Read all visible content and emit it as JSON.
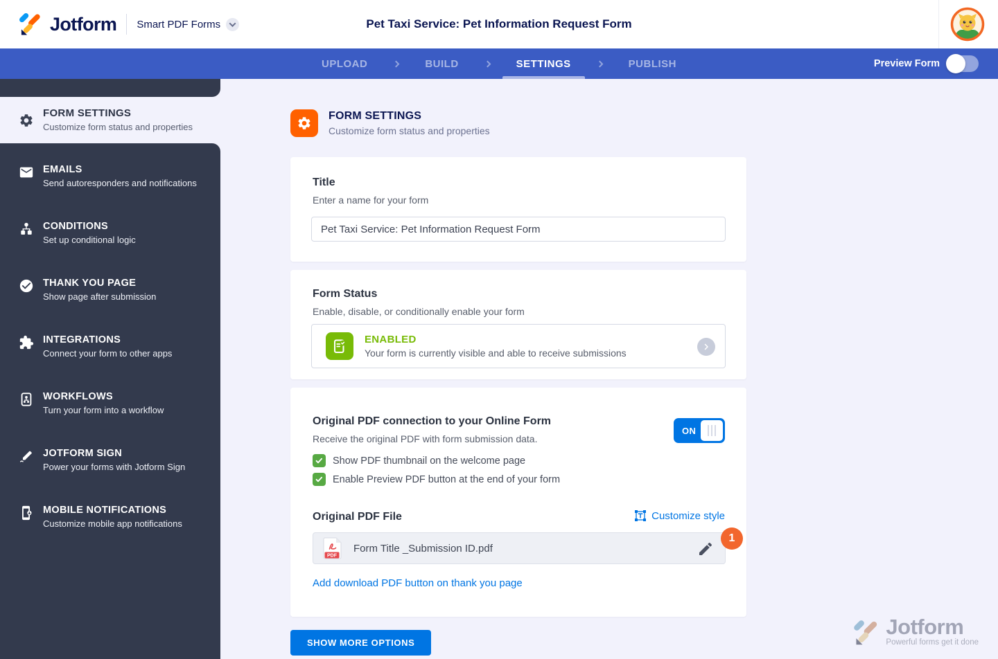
{
  "header": {
    "brand": "Jotform",
    "product": "Smart PDF Forms",
    "page_title": "Pet Taxi Service: Pet Information Request Form"
  },
  "navbar": {
    "tabs": [
      {
        "label": "UPLOAD",
        "active": false
      },
      {
        "label": "BUILD",
        "active": false
      },
      {
        "label": "SETTINGS",
        "active": true
      },
      {
        "label": "PUBLISH",
        "active": false
      }
    ],
    "preview_label": "Preview Form",
    "preview_toggle_state": "off"
  },
  "sidebar": {
    "items": [
      {
        "label": "FORM SETTINGS",
        "description": "Customize form status and properties",
        "icon": "gear-icon",
        "active": true
      },
      {
        "label": "EMAILS",
        "description": "Send autoresponders and notifications",
        "icon": "envelope-icon",
        "active": false
      },
      {
        "label": "CONDITIONS",
        "description": "Set up conditional logic",
        "icon": "flowchart-icon",
        "active": false
      },
      {
        "label": "THANK YOU PAGE",
        "description": "Show page after submission",
        "icon": "check-circle-icon",
        "active": false
      },
      {
        "label": "INTEGRATIONS",
        "description": "Connect your form to other apps",
        "icon": "puzzle-icon",
        "active": false
      },
      {
        "label": "WORKFLOWS",
        "description": "Turn your form into a workflow",
        "icon": "workflow-icon",
        "active": false
      },
      {
        "label": "JOTFORM SIGN",
        "description": "Power your forms with Jotform Sign",
        "icon": "sign-pen-icon",
        "active": false
      },
      {
        "label": "MOBILE NOTIFICATIONS",
        "description": "Customize mobile app notifications",
        "icon": "mobile-icon",
        "active": false
      }
    ]
  },
  "main": {
    "section": {
      "title": "FORM SETTINGS",
      "subtitle": "Customize form status and properties"
    },
    "title_card": {
      "label": "Title",
      "hint": "Enter a name for your form",
      "value": "Pet Taxi Service: Pet Information Request Form"
    },
    "status_card": {
      "label": "Form Status",
      "hint": "Enable, disable, or conditionally enable your form",
      "status": "ENABLED",
      "status_description": "Your form is currently visible and able to receive submissions"
    },
    "pdf_card": {
      "title": "Original PDF connection to your Online Form",
      "subtitle": "Receive the original PDF with form submission data.",
      "toggle_label": "ON",
      "toggle_state": "on",
      "checkboxes": [
        "Show PDF thumbnail on the welcome page",
        "Enable Preview PDF button at the end of your form"
      ],
      "file_label": "Original PDF File",
      "customize_link": "Customize style",
      "file_name": "Form Title _Submission ID.pdf",
      "pdf_badge": "PDF",
      "step_badge": "1",
      "download_link": "Add download PDF button on thank you page"
    },
    "show_more_button": "SHOW MORE OPTIONS"
  },
  "watermark": {
    "brand": "Jotform",
    "tagline": "Powerful forms get it done"
  },
  "colors": {
    "navbar_blue": "#3b5cc4",
    "sidebar_dark": "#333a4d",
    "page_background": "#f2f2fc",
    "brand_navy": "#0a1551",
    "accent_orange": "#ff6100",
    "enabled_green": "#78bb07",
    "checkbox_green": "#57a943",
    "action_blue": "#0075e3",
    "badge_orange": "#f2662d"
  }
}
